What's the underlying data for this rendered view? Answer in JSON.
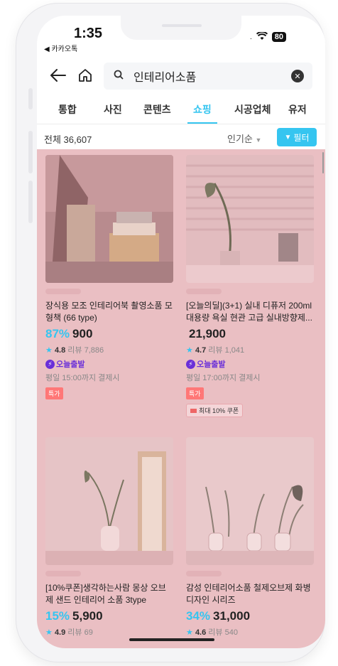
{
  "status": {
    "time": "1:35",
    "back_app": "◀ 카카오톡",
    "battery": "80"
  },
  "search": {
    "query": "인테리어소품"
  },
  "tabs": [
    {
      "label": "통합"
    },
    {
      "label": "사진"
    },
    {
      "label": "콘텐츠"
    },
    {
      "label": "쇼핑",
      "active": true
    },
    {
      "label": "시공업체"
    },
    {
      "label": "유저"
    }
  ],
  "filterbar": {
    "total": "전체 36,607",
    "sort": "인기순",
    "filter_label": "필터"
  },
  "products": [
    {
      "name": "장식용 모조 인테리어북 촬영소품 모형책 (66 type)",
      "discount": "87%",
      "price": "900",
      "rating": "4.8",
      "reviews": "리뷰 7,886",
      "delivery": "오늘출발",
      "deadline": "평일 15:00까지 결제시",
      "badge": "특가"
    },
    {
      "name": "[오늘의딜](3+1) 실내 디퓨저 200ml 대용량 욕실 현관 고급 실내방향제...",
      "discount": "",
      "price": "21,900",
      "rating": "4.7",
      "reviews": "리뷰 1,041",
      "delivery": "오늘출발",
      "deadline": "평일 17:00까지 결제시",
      "badge": "특가",
      "coupon": "최대 10% 쿠폰"
    },
    {
      "name": "[10%쿠폰]생각하는사람 몽상 오브제 샌드 인테리어 소품 3type",
      "discount": "15%",
      "price": "5,900",
      "rating": "4.9",
      "reviews": "리뷰 69"
    },
    {
      "name": "감성 인테리어소품 철제오브제 화병디자인 시리즈",
      "discount": "34%",
      "price": "31,000",
      "rating": "4.6",
      "reviews": "리뷰 540"
    }
  ],
  "colors": {
    "accent": "#35c5f0",
    "overlay": "#eabfc3",
    "today_purple": "#6a2fd8"
  }
}
